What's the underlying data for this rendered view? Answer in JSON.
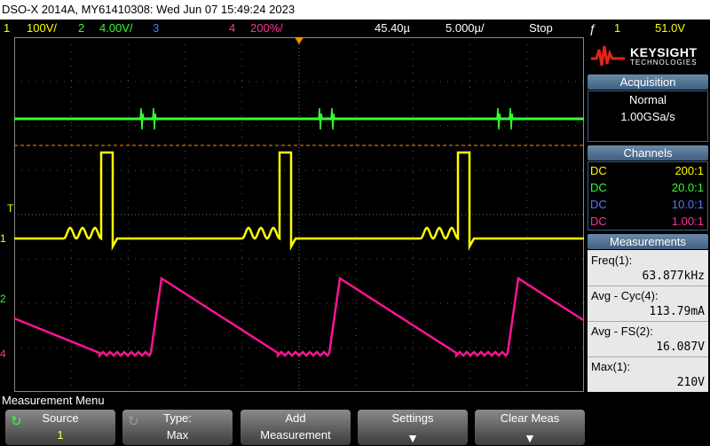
{
  "title_bar": "DSO-X 2014A, MY61410308: Wed Jun 07 15:49:24 2023",
  "status": {
    "ch1_num": "1",
    "ch1_scale": "100V/",
    "ch2_num": "2",
    "ch2_scale": "4.00V/",
    "ch3_num": "3",
    "ch4_num": "4",
    "ch4_scale": "200%/",
    "time_delay": "45.40µ",
    "time_scale": "5.000µ/",
    "run_state": "Stop",
    "trigger_icon": "trigger-edge-icon",
    "trigger_channel": "1",
    "trigger_level": "51.0V"
  },
  "logo": {
    "brand": "KEYSIGHT",
    "sub": "TECHNOLOGIES"
  },
  "acquisition": {
    "header": "Acquisition",
    "mode": "Normal",
    "rate": "1.00GSa/s"
  },
  "channels": {
    "header": "Channels",
    "rows": [
      {
        "coupling": "DC",
        "probe": "200:1",
        "color": "#ffff00"
      },
      {
        "coupling": "DC",
        "probe": "20.0:1",
        "color": "#33ff33"
      },
      {
        "coupling": "DC",
        "probe": "10.0:1",
        "color": "#5577ff"
      },
      {
        "coupling": "DC",
        "probe": "1.00:1",
        "color": "#ff3399"
      }
    ]
  },
  "measurements": {
    "header": "Measurements",
    "items": [
      {
        "name": "Freq(1):",
        "value": "63.877kHz"
      },
      {
        "name": "Avg - Cyc(4):",
        "value": "113.79mA"
      },
      {
        "name": "Avg - FS(2):",
        "value": "16.087V"
      },
      {
        "name": "Max(1):",
        "value": "210V"
      }
    ]
  },
  "menu": {
    "label": "Measurement Menu",
    "keys": [
      {
        "l1": "Source",
        "l2": "1",
        "icon": "rotate-knob-icon"
      },
      {
        "l1": "Type:",
        "l2": "Max",
        "icon": "rotate-knob-icon"
      },
      {
        "l1": "Add",
        "l2": "Measurement",
        "icon": ""
      },
      {
        "l1": "Settings",
        "l2": "",
        "icon": "down-arrow-icon"
      },
      {
        "l1": "Clear Meas",
        "l2": "",
        "icon": "down-arrow-icon"
      }
    ]
  },
  "markers": {
    "ch1": "1",
    "ch2": "2",
    "ch4": "4",
    "trig": "T"
  },
  "colors": {
    "ch1": "#ffff00",
    "ch2": "#33ff33",
    "ch3": "#5577ff",
    "ch4": "#ff1493",
    "trigger_level": "#ff8c00",
    "panel_header": "#4f6f90"
  }
}
